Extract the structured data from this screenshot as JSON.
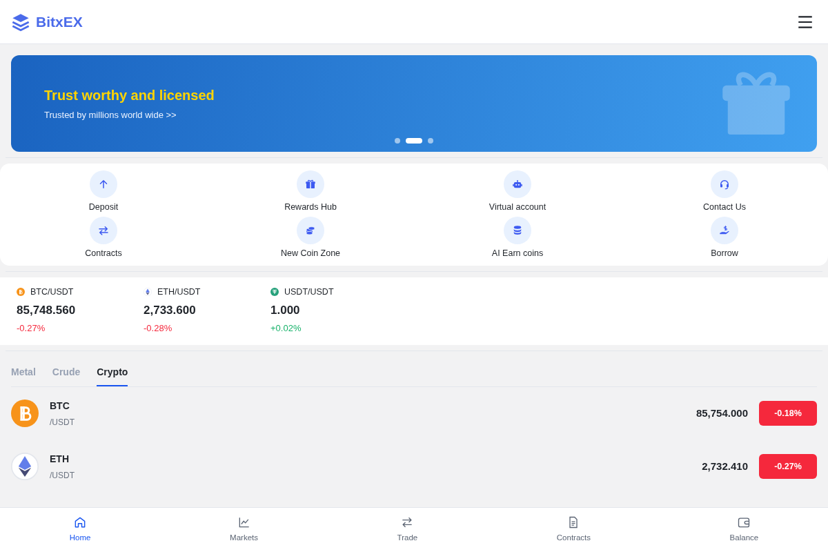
{
  "header": {
    "brand": "BitxEX"
  },
  "banner": {
    "title": "Trust worthy and licensed",
    "subtitle": "Trusted by millions world wide >>",
    "dots": [
      {
        "selected": false
      },
      {
        "selected": true
      },
      {
        "selected": false
      }
    ]
  },
  "shortcuts": [
    {
      "kind": "arrow-up",
      "label": "Deposit"
    },
    {
      "kind": "gift",
      "label": "Rewards Hub"
    },
    {
      "kind": "robot",
      "label": "Virtual account"
    },
    {
      "kind": "headset",
      "label": "Contact Us"
    },
    {
      "kind": "swap",
      "label": "Contracts"
    },
    {
      "kind": "coins",
      "label": "New Coin Zone"
    },
    {
      "kind": "database",
      "label": "AI Earn coins"
    },
    {
      "kind": "hand",
      "label": "Borrow"
    }
  ],
  "tickers": [
    {
      "kind": "btc",
      "pair": "BTC/USDT",
      "price": "85,748.560",
      "change": "-0.27%",
      "color": "#f5283c"
    },
    {
      "kind": "eth",
      "pair": "ETH/USDT",
      "price": "2,733.600",
      "change": "-0.28%",
      "color": "#f5283c"
    },
    {
      "kind": "usdt",
      "pair": "USDT/USDT",
      "price": "1.000",
      "change": "+0.02%",
      "color": "#17b26a"
    }
  ],
  "tabs": [
    {
      "label": "Metal",
      "selected": false
    },
    {
      "label": "Crude",
      "selected": false
    },
    {
      "label": "Crypto",
      "selected": true
    }
  ],
  "markets": [
    {
      "kind": "btc",
      "symbol": "BTC",
      "quote": "/USDT",
      "price": "85,754.000",
      "change": "-0.18%",
      "color": "#f5283c"
    },
    {
      "kind": "eth",
      "symbol": "ETH",
      "quote": "/USDT",
      "price": "2,732.410",
      "change": "-0.27%",
      "color": "#f5283c"
    }
  ],
  "bottom_nav": [
    {
      "kind": "home",
      "label": "Home",
      "selected": true
    },
    {
      "kind": "chart",
      "label": "Markets",
      "selected": false
    },
    {
      "kind": "swap",
      "label": "Trade",
      "selected": false
    },
    {
      "kind": "doc",
      "label": "Contracts",
      "selected": false
    },
    {
      "kind": "wallet",
      "label": "Balance",
      "selected": false
    }
  ]
}
